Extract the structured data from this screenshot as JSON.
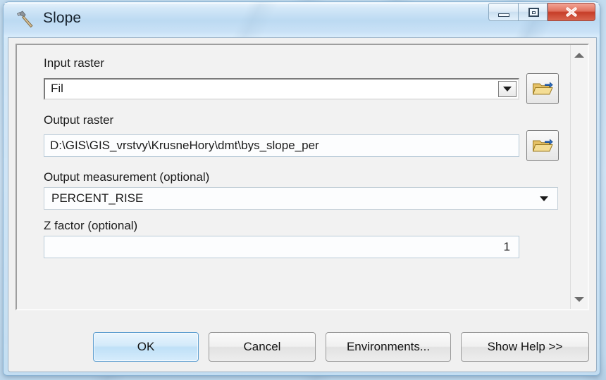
{
  "window": {
    "title": "Slope",
    "icon": "hammer-icon",
    "controls": {
      "minimize": "minimize-icon",
      "restore": "restore-icon",
      "close": "close-icon"
    }
  },
  "form": {
    "fields": [
      {
        "label": "Input raster",
        "value": "Fil",
        "kind": "combo",
        "browse": true,
        "browse_icon": "open-folder-icon"
      },
      {
        "label": "Output raster",
        "value": "D:\\GIS\\GIS_vrstvy\\KrusneHory\\dmt\\bys_slope_per",
        "kind": "text",
        "browse": true,
        "browse_icon": "open-folder-icon"
      },
      {
        "label": "Output measurement (optional)",
        "value": "PERCENT_RISE",
        "kind": "flat-combo",
        "browse": false
      },
      {
        "label": "Z factor (optional)",
        "value": "1",
        "kind": "number",
        "browse": false
      }
    ]
  },
  "scrollbar": {
    "up_icon": "scroll-up-arrow-icon",
    "down_icon": "scroll-down-arrow-icon"
  },
  "buttons": {
    "ok": "OK",
    "cancel": "Cancel",
    "environments": "Environments...",
    "show_help": "Show Help >>"
  },
  "colors": {
    "accent": "#bfe0f7",
    "accent_border": "#5f9fd0",
    "close_red": "#c63d28",
    "dialog_bg": "#f0f0f0",
    "folder_yellow": "#e8c96a",
    "folder_arrow_blue": "#2f6fc0"
  }
}
